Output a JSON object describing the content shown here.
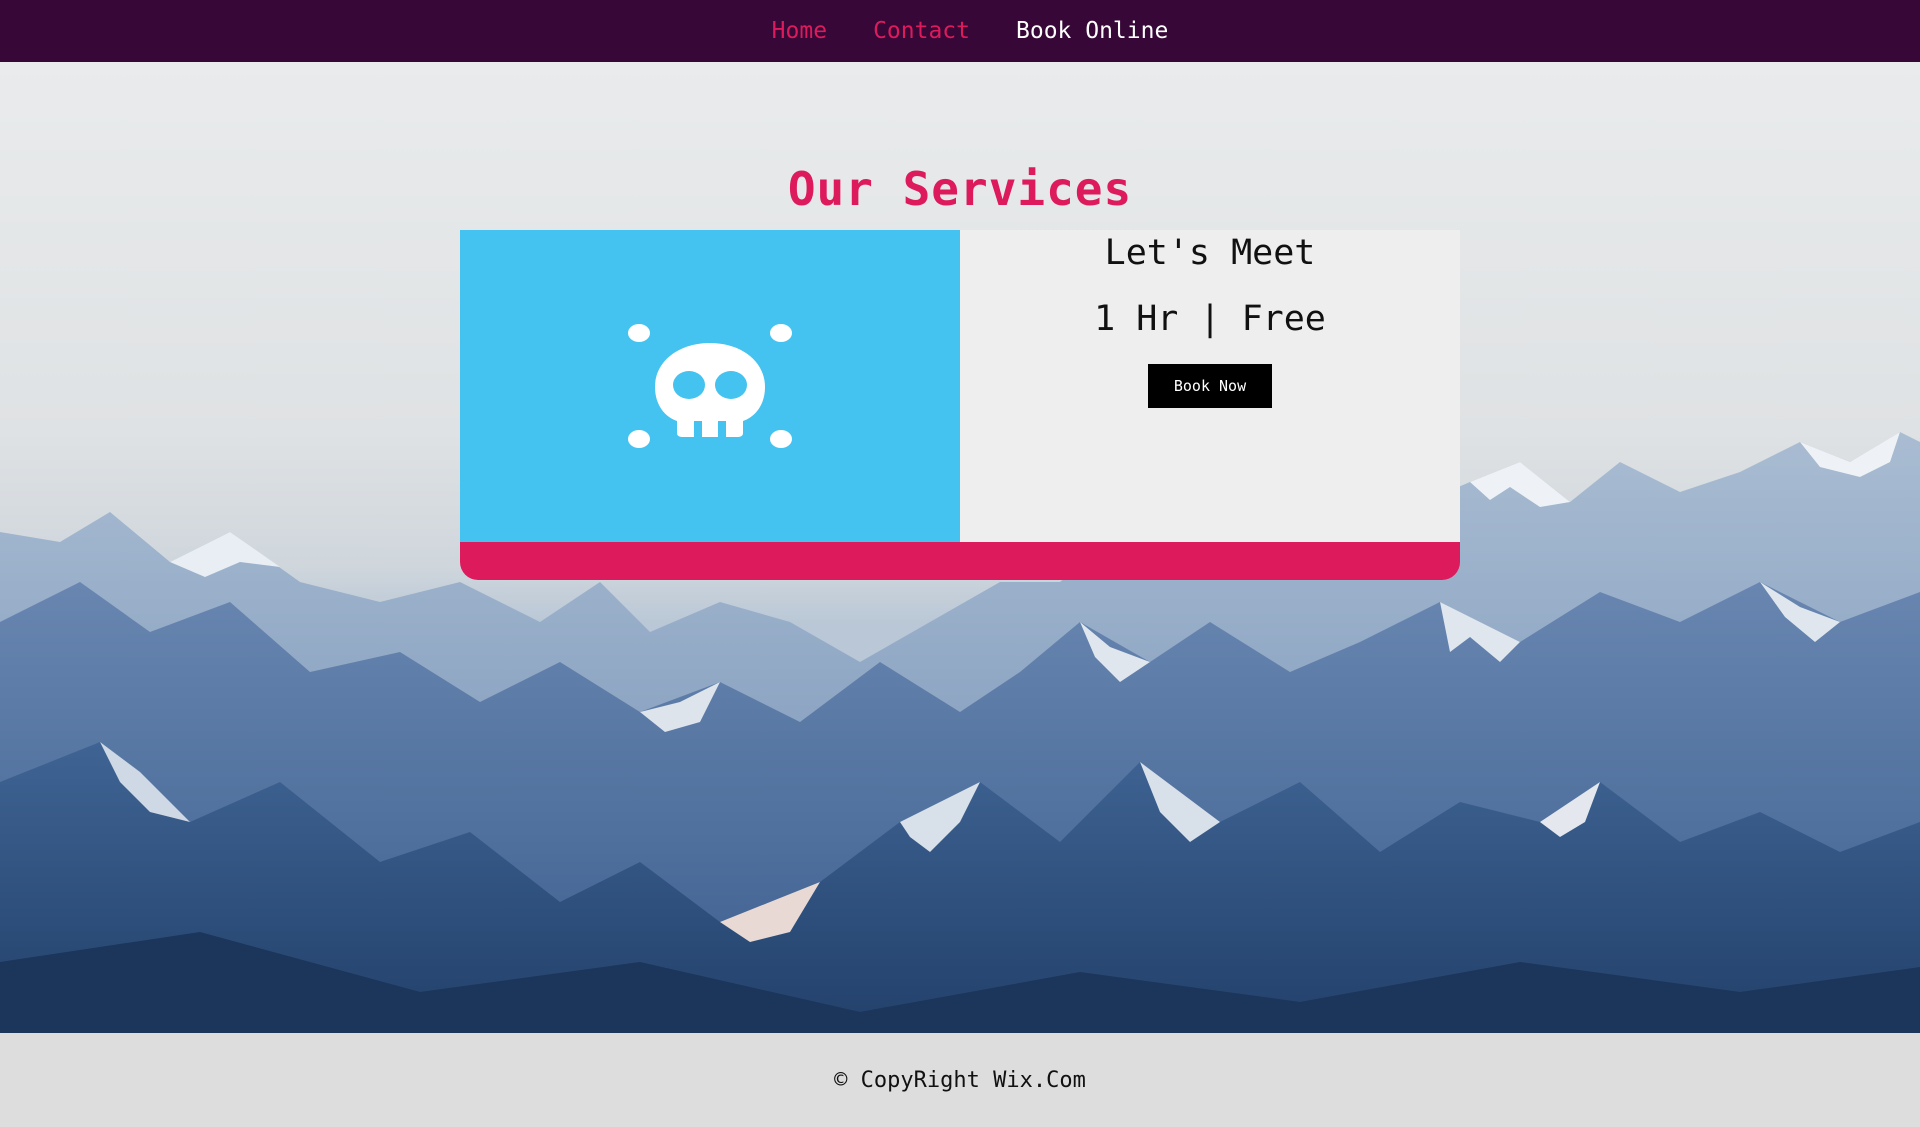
{
  "nav": {
    "items": [
      {
        "label": "Home",
        "active": false
      },
      {
        "label": "Contact",
        "active": false
      },
      {
        "label": "Book Online",
        "active": true
      }
    ]
  },
  "services": {
    "title": "Our Services",
    "card": {
      "image_icon": "skull-icon",
      "name": "Let's Meet",
      "meta": "1 Hr | Free",
      "button_label": "Book Now"
    }
  },
  "footer": {
    "text": "© CopyRight Wix.Com"
  },
  "colors": {
    "nav_bg": "#360737",
    "accent": "#dd1a5c",
    "card_image_bg": "#44c2f0",
    "card_info_bg": "#eeeeee",
    "footer_bg": "#dddddd"
  }
}
